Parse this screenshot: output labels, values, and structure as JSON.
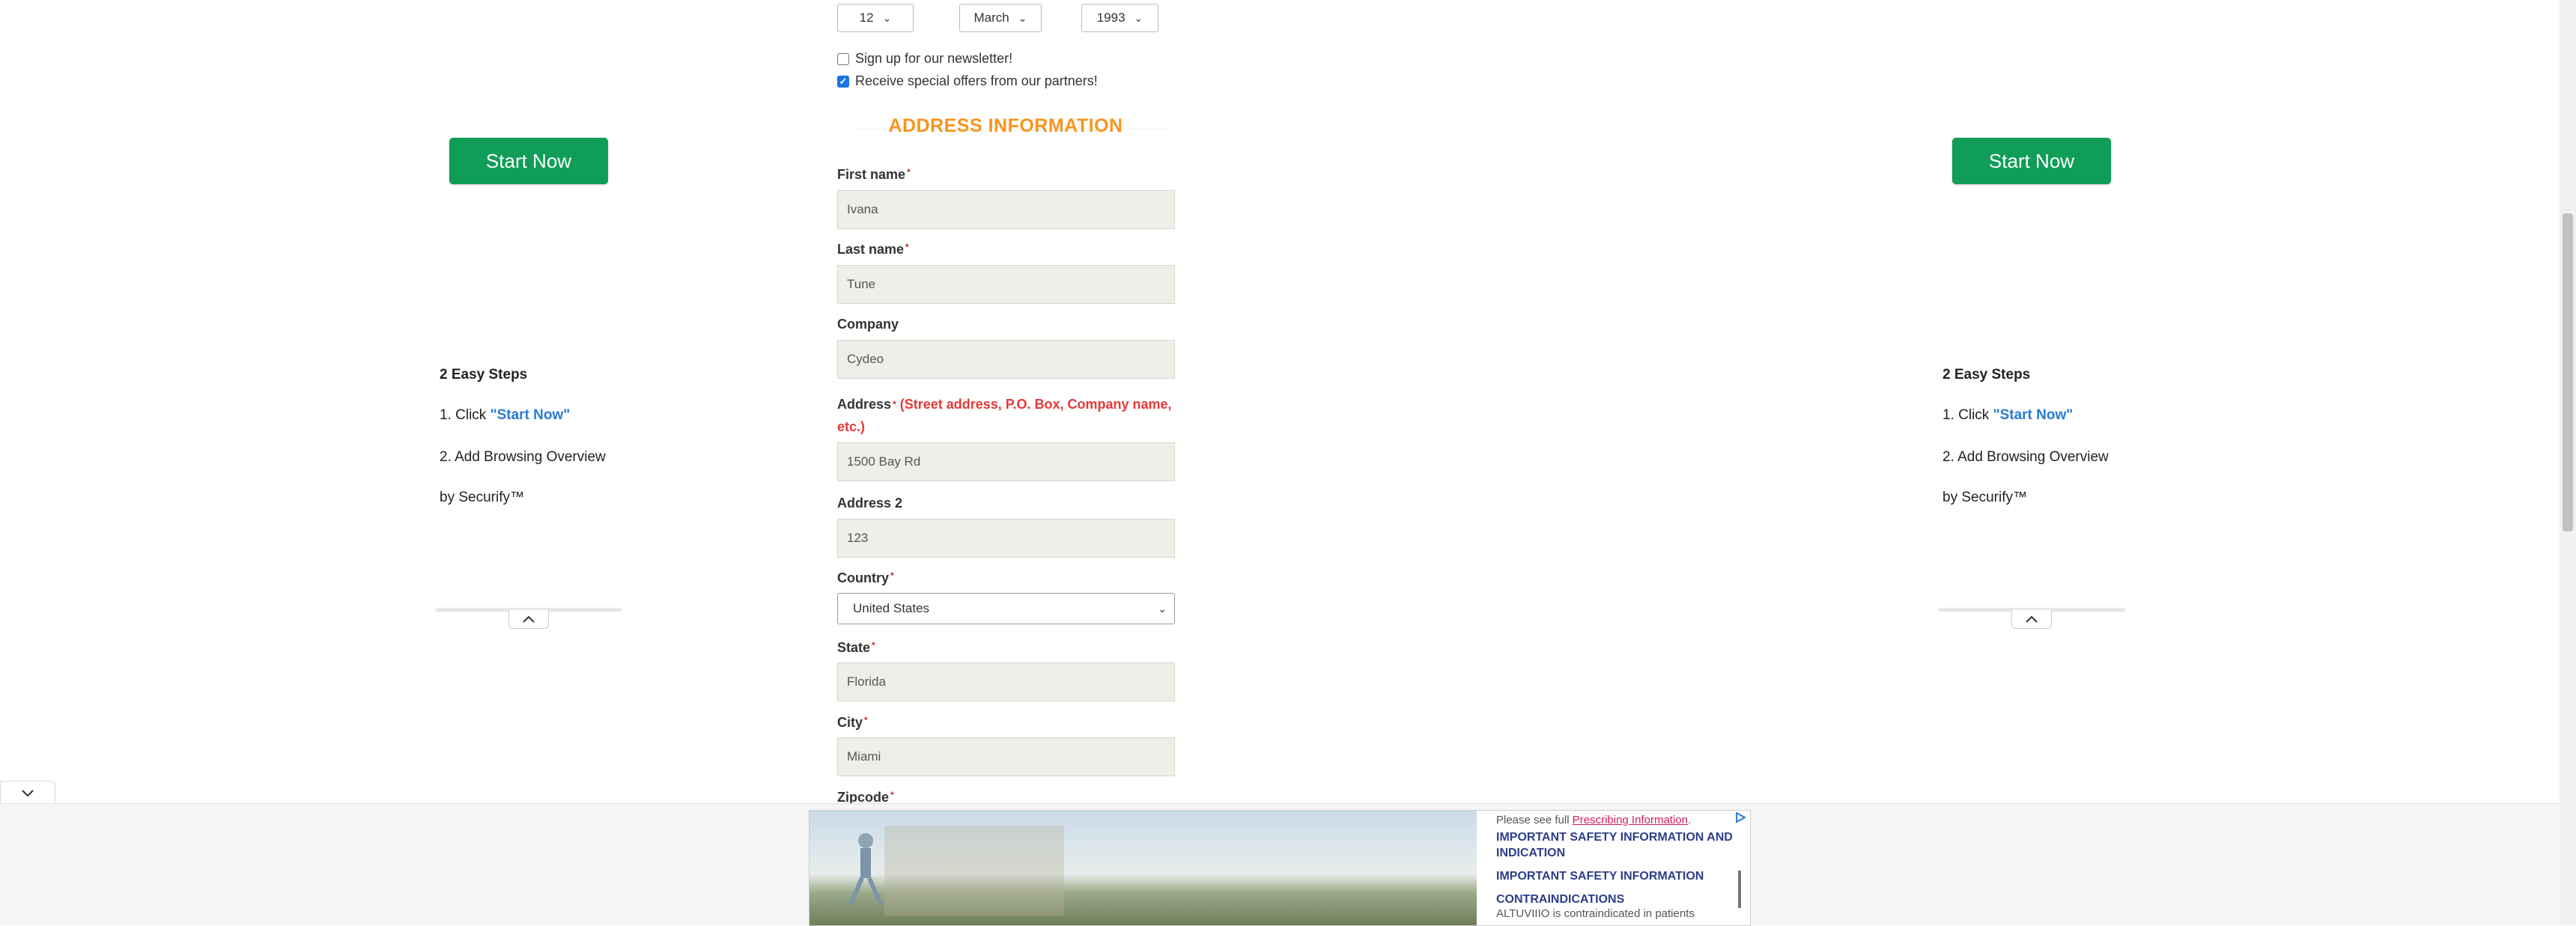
{
  "dob": {
    "day": "12",
    "month": "March",
    "year": "1993"
  },
  "checkboxes": [
    {
      "label": "Sign up for our newsletter!",
      "checked": false
    },
    {
      "label": "Receive special offers from our partners!",
      "checked": true
    }
  ],
  "section_title": "ADDRESS INFORMATION",
  "fields": {
    "first_name": {
      "label": "First name",
      "value": "Ivana"
    },
    "last_name": {
      "label": "Last name",
      "value": "Tune"
    },
    "company": {
      "label": "Company",
      "value": "Cydeo"
    },
    "address": {
      "label": "Address",
      "hint": "(Street address, P.O. Box, Company name,",
      "hint2": "etc.)",
      "value": "1500 Bay Rd"
    },
    "address2": {
      "label": "Address 2",
      "value": "123"
    },
    "country": {
      "label": "Country",
      "value": "United States"
    },
    "state": {
      "label": "State",
      "value": "Florida"
    },
    "city": {
      "label": "City",
      "value": "Miami"
    },
    "zipcode": {
      "label": "Zipcode"
    }
  },
  "side_ad": {
    "button": "Start Now",
    "steps_title": "2 Easy Steps",
    "step1_prefix": "1. Click ",
    "step1_link": "\"Start Now\"",
    "step2": "2. Add Browsing Overview",
    "step2b": "by Securify™"
  },
  "bottom_ad": {
    "intro": "Please see full ",
    "intro_link": "Prescribing Information",
    "intro_end": ".",
    "heading1": "IMPORTANT SAFETY INFORMATION AND INDICATION",
    "heading2": "IMPORTANT SAFETY INFORMATION",
    "heading3": "CONTRAINDICATIONS",
    "body": "ALTUVIIIO is contraindicated in patients"
  },
  "colors": {
    "accent_orange": "#f7941d",
    "button_green": "#0f9d58",
    "link_blue": "#2a7bd6",
    "hint_red": "#e53935"
  }
}
